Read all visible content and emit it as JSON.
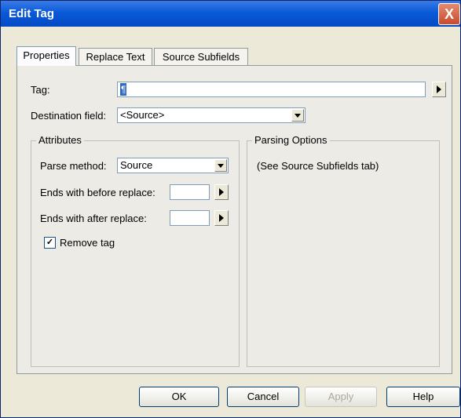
{
  "window": {
    "title": "Edit Tag",
    "close_glyph": "X"
  },
  "tabs": [
    {
      "label": "Properties",
      "active": true
    },
    {
      "label": "Replace Text",
      "active": false
    },
    {
      "label": "Source Subfields",
      "active": false
    }
  ],
  "tag": {
    "label": "Tag:",
    "value": "¶"
  },
  "destination": {
    "label": "Destination field:",
    "value": "<Source>"
  },
  "attributes": {
    "title": "Attributes",
    "parse_method": {
      "label": "Parse method:",
      "value": "Source"
    },
    "ends_before": {
      "label": "Ends with before replace:",
      "value": ""
    },
    "ends_after": {
      "label": "Ends with after replace:",
      "value": ""
    },
    "remove_tag": {
      "label": "Remove tag",
      "checked": true,
      "check_glyph": "✓"
    }
  },
  "parsing": {
    "title": "Parsing Options",
    "note": "(See Source Subfields tab)"
  },
  "buttons": {
    "ok": "OK",
    "cancel": "Cancel",
    "apply": "Apply",
    "help": "Help"
  }
}
